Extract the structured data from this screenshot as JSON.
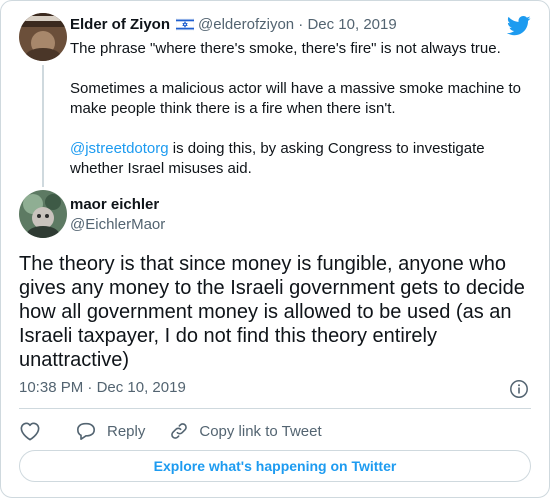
{
  "parent_tweet": {
    "author_name": "Elder of Ziyon",
    "handle": "@elderofziyon",
    "separator": "·",
    "date": "Dec 10, 2019",
    "flag_icon": "israel-flag-icon",
    "paragraphs": [
      "The phrase \"where there's smoke, there's fire\" is not always true.",
      "Sometimes a malicious actor will have a massive smoke machine to make people think there is a fire when there isn't."
    ],
    "mention": "@jstreetdotorg",
    "mention_text": " is doing this, by asking Congress to investigate whether Israel misuses aid."
  },
  "main_tweet": {
    "author_name": "maor eichler",
    "handle": "@EichlerMaor",
    "text": "The theory is that since money is fungible, anyone who gives any money to the Israeli government gets to decide how all government money is allowed to be used (as an Israeli taxpayer, I do not find this theory entirely unattractive)",
    "time": "10:38 PM",
    "separator": "·",
    "date": "Dec 10, 2019"
  },
  "actions": {
    "like_icon": "heart-icon",
    "reply_label": "Reply",
    "copy_link_label": "Copy link to Tweet"
  },
  "explore_label": "Explore what's happening on Twitter",
  "colors": {
    "accent": "#1d9bf0",
    "text": "#0f1419",
    "muted": "#536471",
    "border": "#cfd9de"
  }
}
